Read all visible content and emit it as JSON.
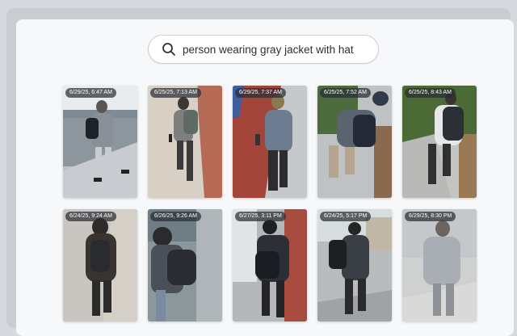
{
  "search": {
    "query": "person wearing gray jacket with hat",
    "icon": "search-icon"
  },
  "results": [
    {
      "timestamp": "6/29/25, 6:47 AM"
    },
    {
      "timestamp": "6/25/25, 7:13 AM"
    },
    {
      "timestamp": "6/29/25, 7:37 AM"
    },
    {
      "timestamp": "6/25/25, 7:52 AM"
    },
    {
      "timestamp": "6/25/25, 8:43 AM"
    },
    {
      "timestamp": "6/24/25, 9:24 AM"
    },
    {
      "timestamp": "6/26/25, 9:26 AM"
    },
    {
      "timestamp": "6/27/25, 3:11 PM"
    },
    {
      "timestamp": "6/24/25, 5:17 PM"
    },
    {
      "timestamp": "6/29/25, 8:30 PM"
    }
  ],
  "colors": {
    "background": "#f6f8fa",
    "frame": "#c9ccd1",
    "search_border": "#c9cdd3",
    "timestamp_bg": "#2c3038"
  }
}
